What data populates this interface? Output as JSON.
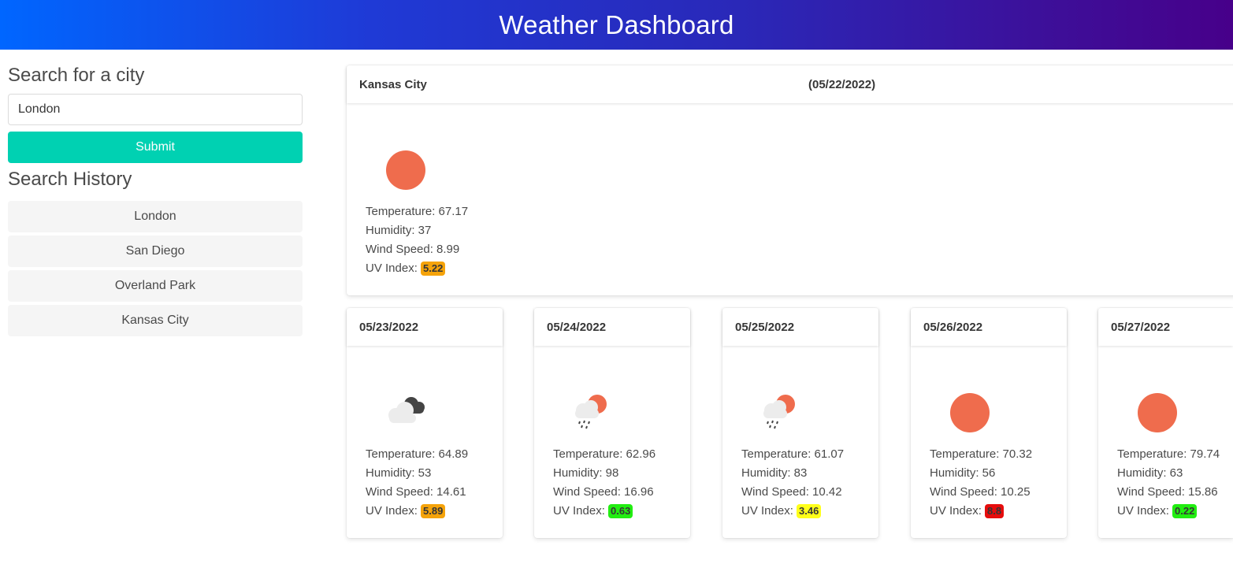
{
  "header": {
    "title": "Weather Dashboard",
    "gradient_start": "#0066ff",
    "gradient_end": "#47008a"
  },
  "sidebar": {
    "search_title": "Search for a city",
    "search_value": "London",
    "submit_label": "Submit",
    "submit_color": "#00d1b2",
    "history_title": "Search History",
    "history": [
      "London",
      "San Diego",
      "Overland Park",
      "Kansas City"
    ]
  },
  "current": {
    "city": "Kansas City",
    "date": "(05/22/2022)",
    "icon": "sun-icon",
    "temperature": "Temperature: 67.17",
    "humidity": "Humidity: 37",
    "wind": "Wind Speed: 8.99",
    "uv_label": "UV Index:",
    "uv": "5.22",
    "uv_color": "#f5a30a"
  },
  "forecast": [
    {
      "date": "05/23/2022",
      "icon": "cloudy-icon",
      "temperature": "Temperature: 64.89",
      "humidity": "Humidity: 53",
      "wind": "Wind Speed: 14.61",
      "uv_label": "UV Index:",
      "uv": "5.89",
      "uv_color": "#f5a30a"
    },
    {
      "date": "05/24/2022",
      "icon": "rain-sun-icon",
      "temperature": "Temperature: 62.96",
      "humidity": "Humidity: 98",
      "wind": "Wind Speed: 16.96",
      "uv_label": "UV Index:",
      "uv": "0.63",
      "uv_color": "#22ee11"
    },
    {
      "date": "05/25/2022",
      "icon": "rain-sun-icon",
      "temperature": "Temperature: 61.07",
      "humidity": "Humidity: 83",
      "wind": "Wind Speed: 10.42",
      "uv_label": "UV Index:",
      "uv": "3.46",
      "uv_color": "#ffff1a"
    },
    {
      "date": "05/26/2022",
      "icon": "sun-icon",
      "temperature": "Temperature: 70.32",
      "humidity": "Humidity: 56",
      "wind": "Wind Speed: 10.25",
      "uv_label": "UV Index:",
      "uv": "8.8",
      "uv_color": "#e60d0d"
    },
    {
      "date": "05/27/2022",
      "icon": "sun-icon",
      "temperature": "Temperature: 79.74",
      "humidity": "Humidity: 63",
      "wind": "Wind Speed: 15.86",
      "uv_label": "UV Index:",
      "uv": "0.22",
      "uv_color": "#22ee11"
    }
  ]
}
